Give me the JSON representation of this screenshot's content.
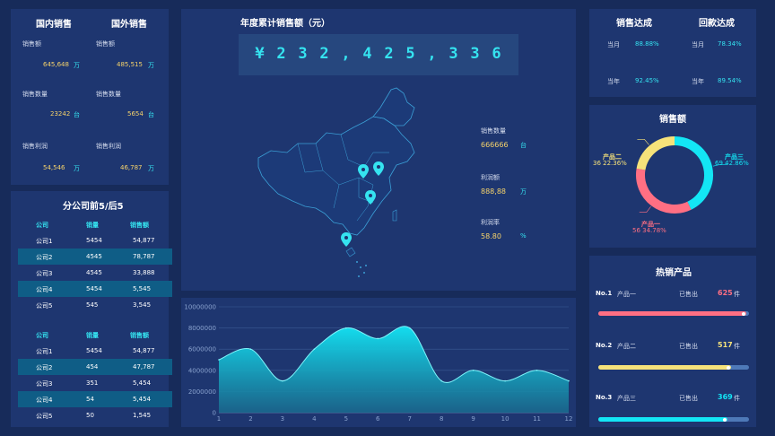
{
  "domestic": {
    "title": "国内销售",
    "sales_label": "销售额",
    "sales_value": "645,648",
    "sales_unit": "万",
    "qty_label": "销售数量",
    "qty_value": "23242",
    "qty_unit": "台",
    "profit_label": "销售利润",
    "profit_value": "54,546",
    "profit_unit": "万"
  },
  "foreign": {
    "title": "国外销售",
    "sales_label": "销售额",
    "sales_value": "485,515",
    "sales_unit": "万",
    "qty_label": "销售数量",
    "qty_value": "5654",
    "qty_unit": "台",
    "profit_label": "销售利润",
    "profit_value": "46,787",
    "profit_unit": "万"
  },
  "branch": {
    "title": "分公司前5/后5",
    "headers": [
      "公司",
      "销量",
      "销售额"
    ],
    "top": [
      [
        "公司1",
        "5454",
        "54,877"
      ],
      [
        "公司2",
        "4545",
        "78,787"
      ],
      [
        "公司3",
        "4545",
        "33,888"
      ],
      [
        "公司4",
        "5454",
        "5,545"
      ],
      [
        "公司5",
        "545",
        "3,545"
      ]
    ],
    "bottom": [
      [
        "公司1",
        "5454",
        "54,877"
      ],
      [
        "公司2",
        "454",
        "47,787"
      ],
      [
        "公司3",
        "351",
        "5,454"
      ],
      [
        "公司4",
        "54",
        "5,454"
      ],
      [
        "公司5",
        "50",
        "1,545"
      ]
    ]
  },
  "annual": {
    "title": "年度累计销售额（元）",
    "digits": [
      "¥",
      "2",
      "3",
      "2",
      ",",
      "4",
      "2",
      "5",
      ",",
      "3",
      "3",
      "6"
    ]
  },
  "map_stats": {
    "qty_label": "销售数量",
    "qty_value": "666666",
    "qty_unit": "台",
    "profit_label": "利润额",
    "profit_value": "888,88",
    "profit_unit": "万",
    "rate_label": "利润率",
    "rate_value": "58.80",
    "rate_unit": "%"
  },
  "achieve": {
    "sales_title": "销售达成",
    "collect_title": "回款达成",
    "month_label": "当月",
    "year_label": "当年",
    "sales_month": "88.88%",
    "sales_year": "92.45%",
    "collect_month": "78.34%",
    "collect_year": "89.54%"
  },
  "colors": {
    "cyan": "#35e3f0",
    "yellow": "#f6e27a",
    "pink": "#ff6f83",
    "panel": "#1e3670",
    "background": "#172b5a"
  },
  "donut": {
    "title": "销售额",
    "items": [
      {
        "name": "产品三",
        "value": 69,
        "percent": "42.86%",
        "color": "#13e6f5"
      },
      {
        "name": "产品一",
        "value": 56,
        "percent": "34.78%",
        "color": "#ff6f83"
      },
      {
        "name": "产品二",
        "value": 36,
        "percent": "22.36%",
        "color": "#f6e27a"
      }
    ],
    "labels": [
      "69  42.86%",
      "56  34.78%",
      "36  22.36%"
    ]
  },
  "hot": {
    "title": "热销产品",
    "sold_label": "已售出",
    "unit": "件",
    "items": [
      {
        "rank": "No.1",
        "name": "产品一",
        "count": "625",
        "ratio": 0.98,
        "color": "#ff6f83"
      },
      {
        "rank": "No.2",
        "name": "产品二",
        "count": "517",
        "ratio": 0.88,
        "color": "#f6e27a"
      },
      {
        "rank": "No.3",
        "name": "产品三",
        "count": "369",
        "ratio": 0.86,
        "color": "#13e6f5"
      }
    ]
  },
  "chart_data": {
    "type": "area",
    "x": [
      1,
      2,
      3,
      4,
      5,
      6,
      7,
      8,
      9,
      10,
      11,
      12
    ],
    "values": [
      5000000,
      6000000,
      3000000,
      6000000,
      8000000,
      7000000,
      8000000,
      3000000,
      4000000,
      3000000,
      4000000,
      3000000
    ],
    "ylim": [
      0,
      10000000
    ],
    "yticks": [
      "10000000",
      "8000000",
      "6000000",
      "4000000",
      "2000000",
      "0"
    ],
    "xticks": [
      "1",
      "2",
      "3",
      "4",
      "5",
      "6",
      "7",
      "8",
      "9",
      "10",
      "11",
      "12"
    ],
    "grid": true,
    "title": "",
    "xlabel": "",
    "ylabel": ""
  }
}
